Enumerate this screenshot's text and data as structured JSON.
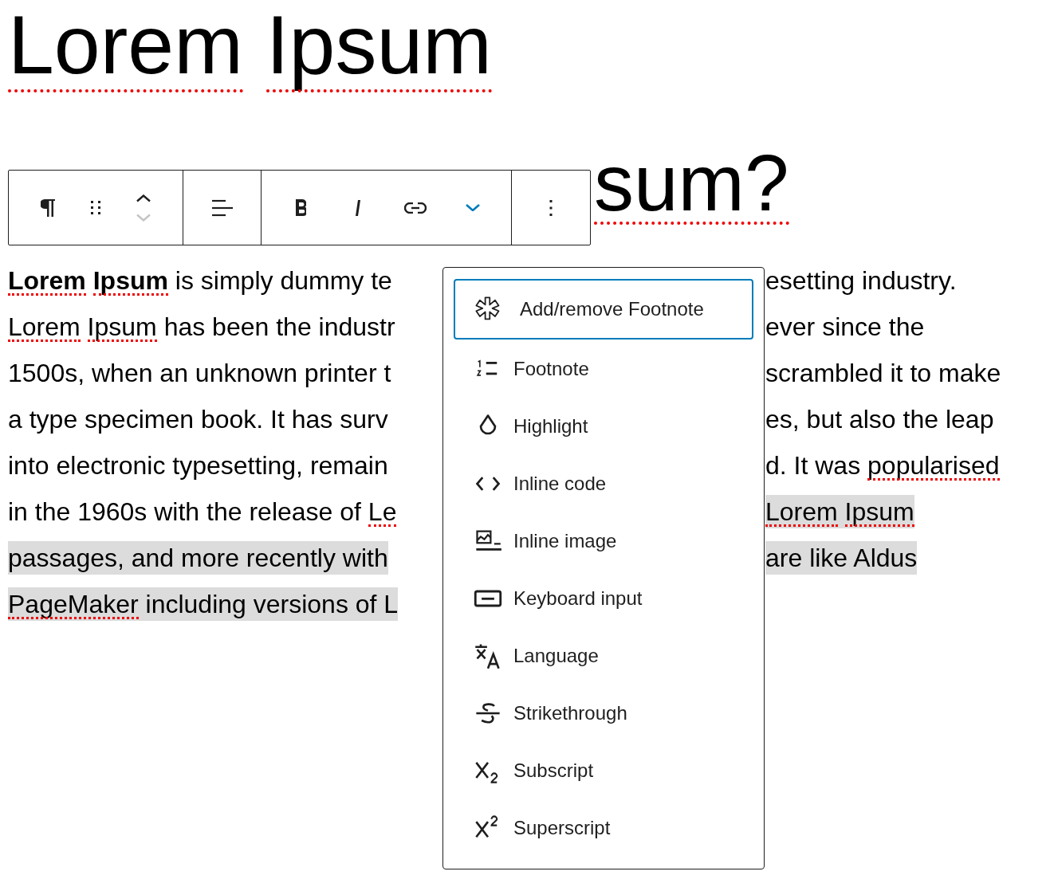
{
  "title": {
    "runs": [
      {
        "text": "Lorem",
        "misspelled": true
      },
      {
        "text": " Ipsum",
        "misspelled": true
      }
    ]
  },
  "heading": {
    "runs": [
      {
        "text": "sum?",
        "misspelled": true
      }
    ]
  },
  "toolbar": {
    "groups": [
      [
        {
          "kind": "paragraph",
          "disabled": false
        },
        {
          "kind": "drag",
          "disabled": false
        },
        {
          "kind": "movers",
          "up_disabled": false,
          "down_disabled": true
        }
      ],
      [
        {
          "kind": "align",
          "disabled": false
        }
      ],
      [
        {
          "kind": "bold",
          "disabled": false
        },
        {
          "kind": "italic",
          "disabled": false
        },
        {
          "kind": "link",
          "disabled": false
        },
        {
          "kind": "chevron",
          "disabled": false,
          "expanded": true
        }
      ],
      [
        {
          "kind": "options",
          "disabled": false
        }
      ]
    ]
  },
  "paragraph": {
    "lines": [
      {
        "left": {
          "selected": false,
          "runs": [
            {
              "text": "**Lorem**",
              "misspelled": true
            },
            {
              "text": " **Ipsum**",
              "misspelled": true
            },
            {
              "text": " is simply dummy te",
              "misspelled": false
            }
          ]
        },
        "right": {
          "selected": false,
          "runs": [
            {
              "text": "esetting industry.",
              "misspelled": false
            }
          ]
        }
      },
      {
        "left": {
          "selected": false,
          "runs": [
            {
              "text": "Lorem",
              "misspelled": true
            },
            {
              "text": " Ipsum",
              "misspelled": true
            },
            {
              "text": " has been the industr",
              "misspelled": false
            }
          ]
        },
        "right": {
          "selected": false,
          "runs": [
            {
              "text": "ever since the",
              "misspelled": false
            }
          ]
        }
      },
      {
        "left": {
          "selected": false,
          "runs": [
            {
              "text": "1500s, when an unknown printer t",
              "misspelled": false
            }
          ]
        },
        "right": {
          "selected": false,
          "runs": [
            {
              "text": "scrambled it to make",
              "misspelled": false
            }
          ]
        }
      },
      {
        "left": {
          "selected": false,
          "runs": [
            {
              "text": "a type specimen book. It has surv",
              "misspelled": false
            }
          ]
        },
        "right": {
          "selected": false,
          "runs": [
            {
              "text": "es, but also the leap",
              "misspelled": false
            }
          ]
        }
      },
      {
        "left": {
          "selected": false,
          "runs": [
            {
              "text": "into electronic typesetting, remain",
              "misspelled": false
            }
          ]
        },
        "right": {
          "selected": false,
          "runs": [
            {
              "text": "d. It was",
              "misspelled": false
            },
            {
              "text": " popularised",
              "misspelled": true
            }
          ]
        }
      },
      {
        "left": {
          "selected": false,
          "runs": [
            {
              "text": "in the 1960s with the release of",
              "misspelled": false
            },
            {
              "text": " Le",
              "misspelled": true
            }
          ]
        },
        "right": {
          "selected": true,
          "runs": [
            {
              "text": "Lorem",
              "misspelled": true
            },
            {
              "text": " Ipsum",
              "misspelled": true
            }
          ]
        }
      },
      {
        "left": {
          "selected": true,
          "runs": [
            {
              "text": "passages, and more recently with",
              "misspelled": false
            }
          ]
        },
        "right": {
          "selected": true,
          "runs": [
            {
              "text": "are like Aldus",
              "misspelled": false
            }
          ]
        }
      },
      {
        "left": {
          "selected": true,
          "runs": [
            {
              "text": "PageMaker",
              "misspelled": true
            },
            {
              "text": " including versions of L",
              "misspelled": false
            }
          ]
        }
      }
    ]
  },
  "menu": {
    "items": [
      {
        "kind": "asterisk",
        "label": "Add/remove Footnote",
        "selected": true
      },
      {
        "kind": "numbered",
        "label": "Footnote",
        "selected": false
      },
      {
        "kind": "drop",
        "label": "Highlight",
        "selected": false
      },
      {
        "kind": "code",
        "label": "Inline code",
        "selected": false
      },
      {
        "kind": "image",
        "label": "Inline image",
        "selected": false
      },
      {
        "kind": "keyboard",
        "label": "Keyboard input",
        "selected": false
      },
      {
        "kind": "language",
        "label": "Language",
        "selected": false
      },
      {
        "kind": "strike",
        "label": "Strikethrough",
        "selected": false
      },
      {
        "kind": "subscript",
        "label": "Subscript",
        "selected": false
      },
      {
        "kind": "superscript",
        "label": "Superscript",
        "selected": false
      }
    ]
  }
}
